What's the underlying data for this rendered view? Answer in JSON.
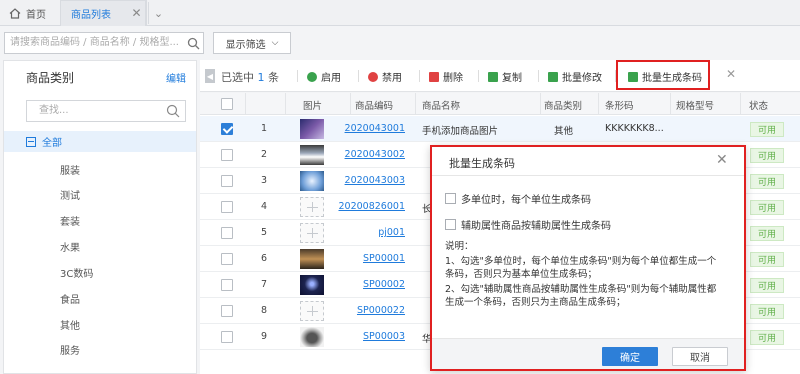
{
  "tabs": {
    "home": "首页",
    "active": "商品列表"
  },
  "search": {
    "placeholder": "请搜索商品编码 / 商品名称 / 规格型...",
    "filter_label": "显示筛选"
  },
  "sidebar": {
    "title": "商品类别",
    "edit": "编辑",
    "search_placeholder": "查找...",
    "all_label": "全部",
    "items": [
      "服装",
      "测试",
      "套装",
      "水果",
      "3C数码",
      "食品",
      "其他",
      "服务"
    ]
  },
  "toolbar": {
    "selected_prefix": "已选中 ",
    "selected_count": "1",
    "selected_suffix": " 条",
    "buttons": [
      "启用",
      "禁用",
      "删除",
      "复制",
      "批量修改",
      "批量生成条码"
    ]
  },
  "table": {
    "headers": [
      "图片",
      "商品编码",
      "商品名称",
      "商品类别",
      "条形码",
      "规格型号",
      "状态"
    ],
    "rows": [
      {
        "n": "1",
        "code": "2020043001",
        "name": "手机添加商品图片",
        "cat": "其他",
        "barcode": "KKKKKKK8...",
        "status": "可用"
      },
      {
        "n": "2",
        "code": "2020043002",
        "name": "",
        "cat": "",
        "barcode": "",
        "status": "可用"
      },
      {
        "n": "3",
        "code": "2020043003",
        "name": "",
        "cat": "",
        "barcode": "",
        "status": "可用"
      },
      {
        "n": "4",
        "code": "20200826001",
        "name": "长",
        "cat": "",
        "barcode": "",
        "status": "可用"
      },
      {
        "n": "5",
        "code": "pj001",
        "name": "",
        "cat": "",
        "barcode": "",
        "status": "可用"
      },
      {
        "n": "6",
        "code": "SP00001",
        "name": "",
        "cat": "",
        "barcode": "",
        "status": "可用"
      },
      {
        "n": "7",
        "code": "SP00002",
        "name": "",
        "cat": "",
        "barcode": "",
        "status": "可用"
      },
      {
        "n": "8",
        "code": "SP000022",
        "name": "",
        "cat": "",
        "barcode": "",
        "status": "可用"
      },
      {
        "n": "9",
        "code": "SP00003",
        "name": "华",
        "cat": "",
        "barcode": "",
        "status": "可用"
      }
    ]
  },
  "modal": {
    "title": "批量生成条码",
    "option1": "多单位时，每个单位生成条码",
    "option2": "辅助属性商品按辅助属性生成条码",
    "desc_title": "说明：",
    "desc1a": "1、勾选\"多单位时，每个单位生成条码\"则为每个单位都生成一个",
    "desc1b": "条码，否则只为基本单位生成条码；",
    "desc2a": "2、勾选\"辅助属性商品按辅助属性生成条码\"则为每个辅助属性都",
    "desc2b": "生成一个条码，否则只为主商品生成条码；",
    "ok": "确定",
    "cancel": "取消"
  },
  "colors": {
    "accent": "#1f7bdc",
    "highlight": "#e02020",
    "status_green": "#61b04a"
  }
}
